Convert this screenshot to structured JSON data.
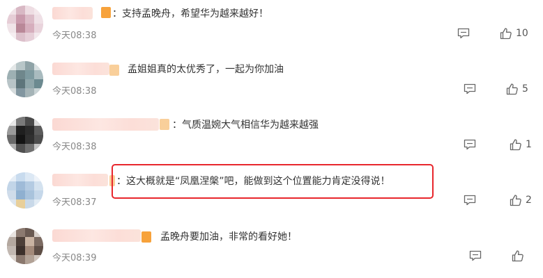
{
  "comments": [
    {
      "text": "：支持孟晚舟，希望华为越来越好！",
      "time": "今天08:38",
      "likes": "10"
    },
    {
      "text": "孟姐姐真的太优秀了，一起为你加油",
      "time": "今天08:38",
      "likes": "5"
    },
    {
      "text": "：气质温婉大气相信华为越来越强",
      "time": "今天08:38",
      "likes": "1"
    },
    {
      "text": "：这大概就是“凤凰涅槃”吧，能做到这个位置能力肯定没得说！",
      "time": "今天08:37",
      "likes": "2"
    },
    {
      "text": "孟晚舟要加油，非常的看好她！",
      "time": "今天08:39",
      "likes": ""
    }
  ],
  "icons": {
    "reply": "comment-icon",
    "like": "thumbs-up-icon"
  },
  "colors": {
    "highlight": "#e8262c",
    "vip_badge": "#f7a23b"
  }
}
